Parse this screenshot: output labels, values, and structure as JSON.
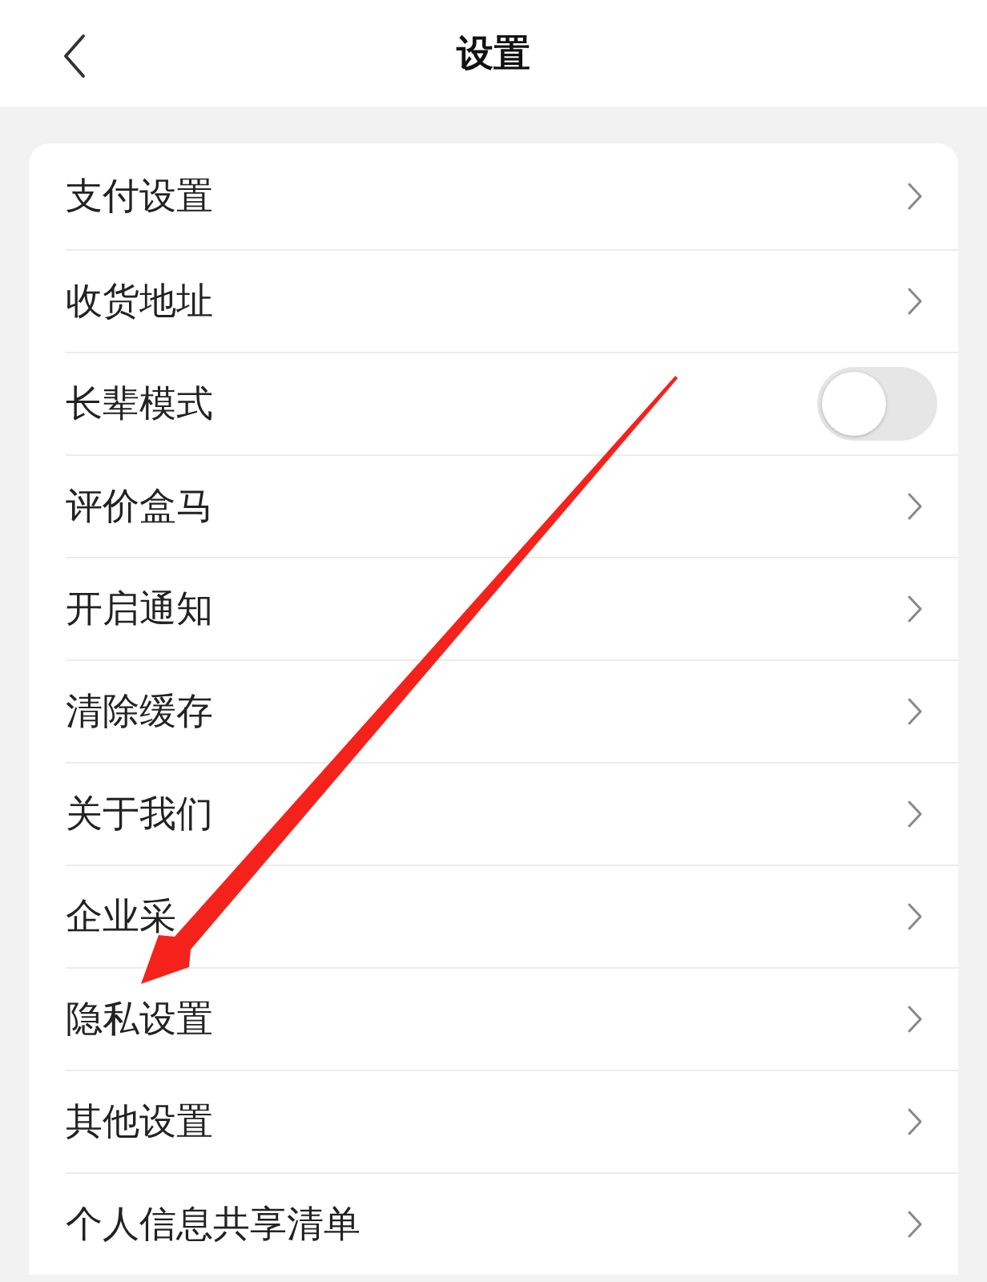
{
  "header": {
    "title": "设置"
  },
  "items": [
    {
      "label": "支付设置",
      "kind": "link"
    },
    {
      "label": "收货地址",
      "kind": "link"
    },
    {
      "label": "长辈模式",
      "kind": "toggle",
      "on": false
    },
    {
      "label": "评价盒马",
      "kind": "link"
    },
    {
      "label": "开启通知",
      "kind": "link"
    },
    {
      "label": "清除缓存",
      "kind": "link"
    },
    {
      "label": "关于我们",
      "kind": "link"
    },
    {
      "label": "企业采",
      "kind": "link"
    },
    {
      "label": "隐私设置",
      "kind": "link"
    },
    {
      "label": "其他设置",
      "kind": "link"
    },
    {
      "label": "个人信息共享清单",
      "kind": "link"
    }
  ]
}
